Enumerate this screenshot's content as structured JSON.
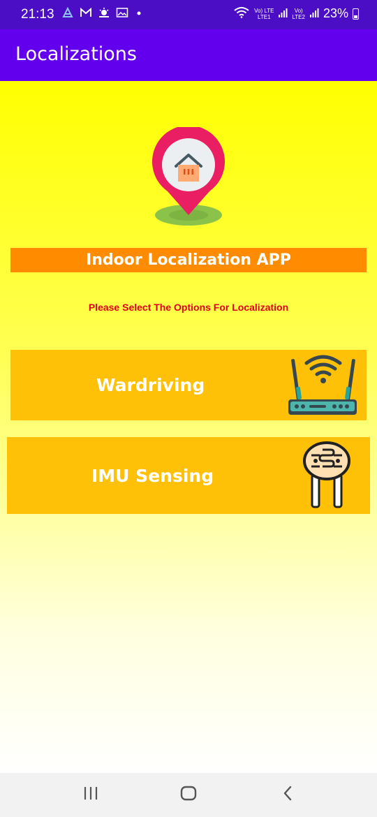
{
  "status_bar": {
    "time": "21:13",
    "left_icons": [
      "notification-app-icon",
      "gmail-icon",
      "weather-icon",
      "gallery-icon",
      "dot-icon"
    ],
    "network_top": "Vo) LTE",
    "network_lte1": "LTE1",
    "network_lte2": "LTE2",
    "battery_percent": "23%"
  },
  "app_bar": {
    "title": "Localizations"
  },
  "main": {
    "banner_title": "Indoor Localization APP",
    "instruction": "Please Select The Options For Localization",
    "options": [
      {
        "label": "Wardriving",
        "icon": "wifi-router-icon"
      },
      {
        "label": "IMU Sensing",
        "icon": "sensor-icon"
      }
    ]
  },
  "colors": {
    "status_bar": "#4b0ec4",
    "app_bar": "#6200ee",
    "banner": "#ff8c00",
    "card": "#ffc107",
    "instruction_text": "#e0001a",
    "gradient_top": "#ffff00",
    "gradient_bottom": "#ffffff"
  },
  "nav_bar": {
    "buttons": [
      "recents-icon",
      "home-icon",
      "back-icon"
    ]
  }
}
